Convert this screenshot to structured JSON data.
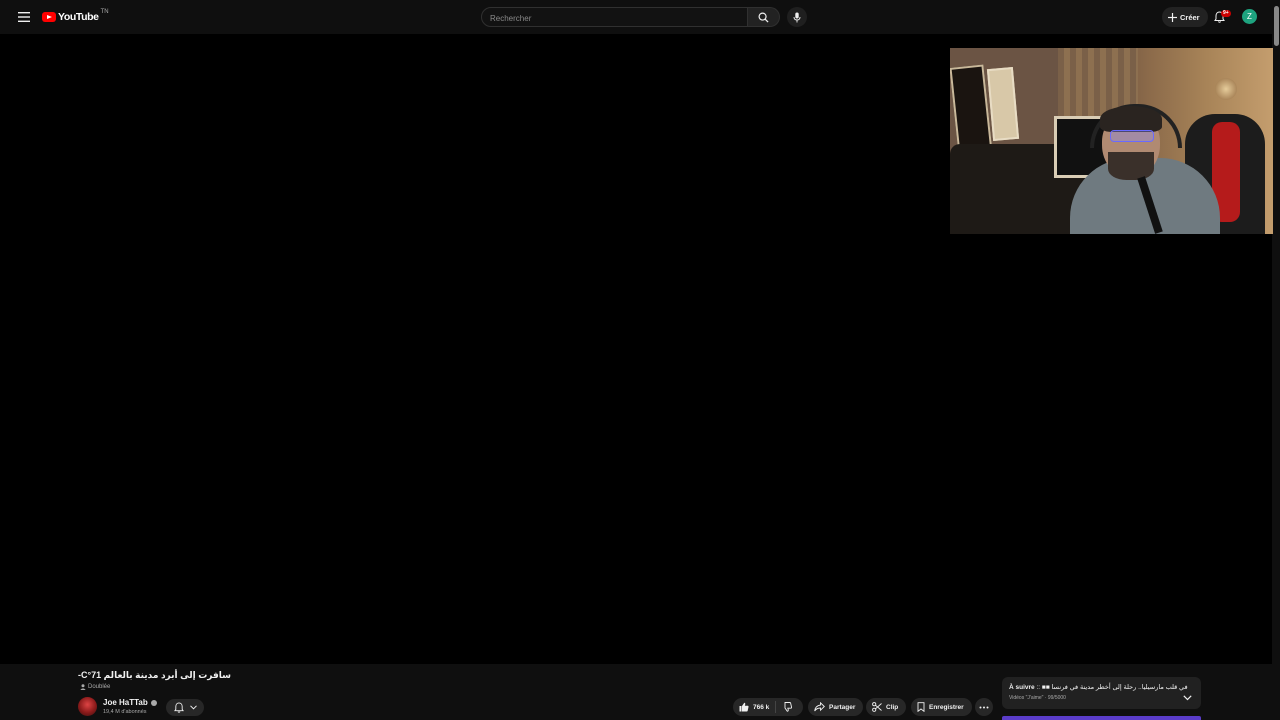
{
  "header": {
    "logo_text": "YouTube",
    "logo_sup": "TN",
    "search_placeholder": "Rechercher",
    "create_label": "Créer",
    "notifications_badge": "9+",
    "avatar_letter": "Z"
  },
  "video": {
    "title": "سافرت إلى أبرد مدينة بالعالم 71°C-",
    "audio_badge": "Doublée",
    "channel_name": "Joe HaTTab",
    "subscribers": "19,4 M d'abonnés",
    "likes": "766 k",
    "share_label": "Partager",
    "clip_label": "Clip",
    "save_label": "Enregistrer"
  },
  "up_next": {
    "prefix": "À suivre",
    "separator": " :: ",
    "title": "في قلب مارسيليا.. رحلة إلى أخطر مدينة في فرنسا ■■",
    "subtitle": "Vidéos \"J'aime\" · 99/5000"
  },
  "colors": {
    "brand_red": "#ff0000",
    "avatar_green": "#1ea37f",
    "progress_purple": "#5a3cc9"
  }
}
